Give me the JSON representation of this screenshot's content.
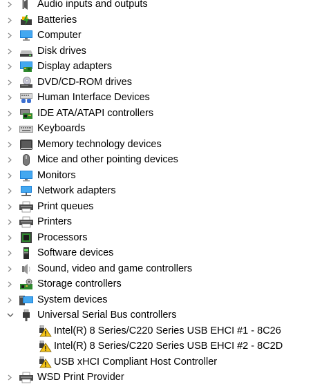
{
  "tree": {
    "items": [
      {
        "label": "Audio inputs and outputs",
        "icon": "speaker-icon",
        "expanded": false
      },
      {
        "label": "Batteries",
        "icon": "battery-icon",
        "expanded": false
      },
      {
        "label": "Computer",
        "icon": "computer-icon",
        "expanded": false
      },
      {
        "label": "Disk drives",
        "icon": "disk-drive-icon",
        "expanded": false
      },
      {
        "label": "Display adapters",
        "icon": "display-adapter-icon",
        "expanded": false
      },
      {
        "label": "DVD/CD-ROM drives",
        "icon": "dvd-drive-icon",
        "expanded": false
      },
      {
        "label": "Human Interface Devices",
        "icon": "hid-icon",
        "expanded": false
      },
      {
        "label": "IDE ATA/ATAPI controllers",
        "icon": "ide-controller-icon",
        "expanded": false
      },
      {
        "label": "Keyboards",
        "icon": "keyboard-icon",
        "expanded": false
      },
      {
        "label": "Memory technology devices",
        "icon": "memory-icon",
        "expanded": false
      },
      {
        "label": "Mice and other pointing devices",
        "icon": "mouse-icon",
        "expanded": false
      },
      {
        "label": "Monitors",
        "icon": "monitor-icon",
        "expanded": false
      },
      {
        "label": "Network adapters",
        "icon": "network-adapter-icon",
        "expanded": false
      },
      {
        "label": "Print queues",
        "icon": "print-queue-icon",
        "expanded": false
      },
      {
        "label": "Printers",
        "icon": "printer-icon",
        "expanded": false
      },
      {
        "label": "Processors",
        "icon": "processor-icon",
        "expanded": false
      },
      {
        "label": "Software devices",
        "icon": "software-device-icon",
        "expanded": false
      },
      {
        "label": "Sound, video and game controllers",
        "icon": "speaker-icon",
        "expanded": false
      },
      {
        "label": "Storage controllers",
        "icon": "storage-controller-icon",
        "expanded": false
      },
      {
        "label": "System devices",
        "icon": "system-devices-icon",
        "expanded": false
      },
      {
        "label": "Universal Serial Bus controllers",
        "icon": "usb-icon",
        "expanded": true,
        "children": [
          {
            "label": "Intel(R) 8 Series/C220 Series USB EHCI #1 - 8C26",
            "icon": "usb-warning-icon"
          },
          {
            "label": "Intel(R) 8 Series/C220 Series USB EHCI #2 - 8C2D",
            "icon": "usb-warning-icon"
          },
          {
            "label": "USB xHCI Compliant Host Controller",
            "icon": "usb-warning-icon"
          }
        ]
      },
      {
        "label": "WSD Print Provider",
        "icon": "printer-icon",
        "expanded": false
      }
    ]
  }
}
